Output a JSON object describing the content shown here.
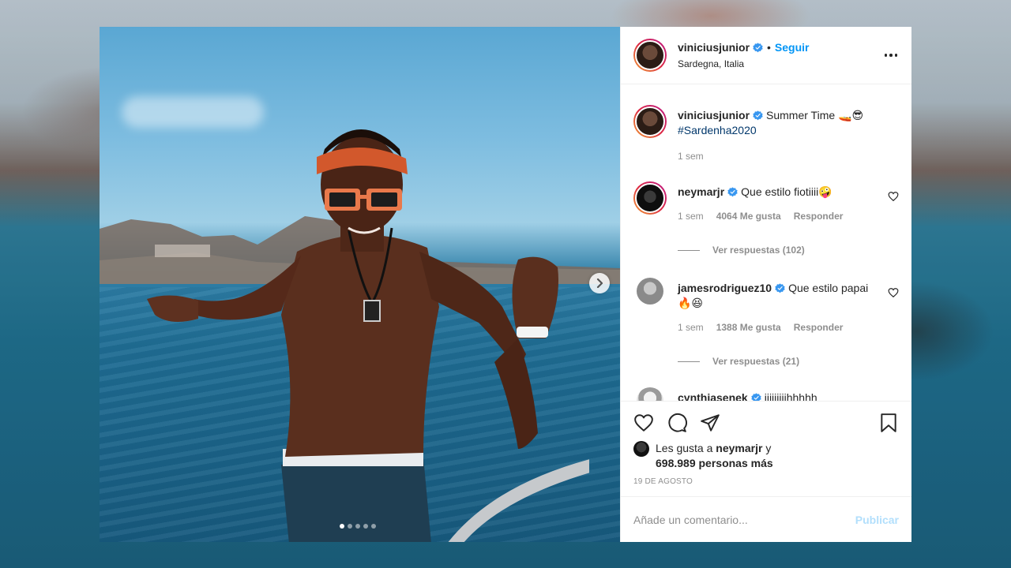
{
  "post": {
    "username": "viniciusjunior",
    "follow_label": "Seguir",
    "separator": "•",
    "location": "Sardegna, Italia",
    "carousel": {
      "total_slides": 5,
      "active_slide": 1
    }
  },
  "caption": {
    "username": "viniciusjunior",
    "text": "Summer Time 🚤😎",
    "hashtag": "#Sardenha2020",
    "time": "1 sem"
  },
  "comments": [
    {
      "username": "neymarjr",
      "text": "Que estilo fiotiiii🤪",
      "time": "1 sem",
      "likes": "4064 Me gusta",
      "reply_label": "Responder",
      "view_replies": "Ver respuestas (102)"
    },
    {
      "username": "jamesrodriguez10",
      "text": "Que estilo papai 🔥😆",
      "time": "1 sem",
      "likes": "1388 Me gusta",
      "reply_label": "Responder",
      "view_replies": "Ver respuestas (21)"
    },
    {
      "username": "cynthiasenek",
      "text": "iiiiiiiiihhhhh"
    }
  ],
  "likes_summary": {
    "prefix": "Les gusta a",
    "user": "neymarjr",
    "connector": "y",
    "count": "698.989 personas más"
  },
  "date": "19 DE AGOSTO",
  "add_comment": {
    "placeholder": "Añade un comentario...",
    "publish_label": "Publicar"
  },
  "colors": {
    "link_blue": "#0095f6",
    "publish_disabled": "#b2dffc",
    "verified": "#3897f0",
    "text": "#262626",
    "muted": "#8e8e8e"
  },
  "icons": [
    "verified-icon",
    "more-options-icon",
    "heart-icon",
    "comment-icon",
    "share-icon",
    "bookmark-icon",
    "chevron-right-icon"
  ]
}
